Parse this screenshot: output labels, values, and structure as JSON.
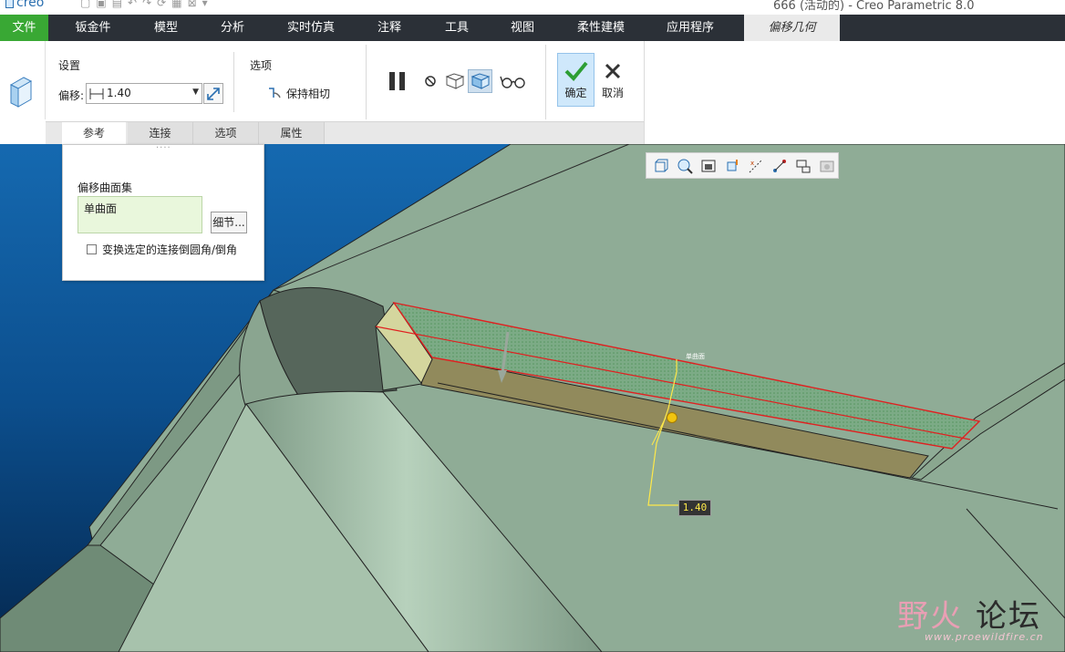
{
  "window": {
    "app_logo": "creo",
    "title": "666 (活动的) - Creo Parametric 8.0"
  },
  "menubar": {
    "tabs": [
      {
        "label": "文件"
      },
      {
        "label": "钣金件"
      },
      {
        "label": "模型"
      },
      {
        "label": "分析"
      },
      {
        "label": "实时仿真"
      },
      {
        "label": "注释"
      },
      {
        "label": "工具"
      },
      {
        "label": "视图"
      },
      {
        "label": "柔性建模"
      },
      {
        "label": "应用程序"
      },
      {
        "label": "偏移几何"
      }
    ],
    "active_tab": "偏移几何"
  },
  "ribbon": {
    "settings_label": "设置",
    "offset_label": "偏移:",
    "offset_value": "1.40",
    "options_label": "选项",
    "keep_tangent_label": "保持相切",
    "confirm_label": "确定",
    "cancel_label": "取消",
    "tabs": [
      {
        "label": "参考"
      },
      {
        "label": "连接"
      },
      {
        "label": "选项"
      },
      {
        "label": "属性"
      }
    ],
    "active_tab": "参考"
  },
  "reference_panel": {
    "grip": "····",
    "surface_set_label": "偏移曲面集",
    "collector_value": "单曲面",
    "details_button": "细节...",
    "checkbox_label": "变换选定的连接倒圆角/倒角",
    "checkbox_checked": false
  },
  "viewport": {
    "surface_tag": "单曲面",
    "dimension_value": "1.40"
  },
  "view_toolbar": {
    "icons": [
      "refit-icon",
      "zoom-in-icon",
      "saved-views-icon",
      "reorient-icon",
      "datum-display-icon",
      "annotation-display-icon",
      "spin-center-icon",
      "display-style-icon"
    ]
  },
  "watermark": {
    "text_cn_1": "野火",
    "text_cn_2": "论坛",
    "url": "www.proewildfire.cn"
  },
  "colors": {
    "menubar_bg": "#2b3037",
    "file_tab": "#39a834",
    "confirm_highlight": "#cfe8fb",
    "model_green": "#8da892",
    "viewport_blue": "#0a4f8c",
    "selected_surface_red": "#e02020",
    "dimension_yellow": "#ffe94a"
  }
}
